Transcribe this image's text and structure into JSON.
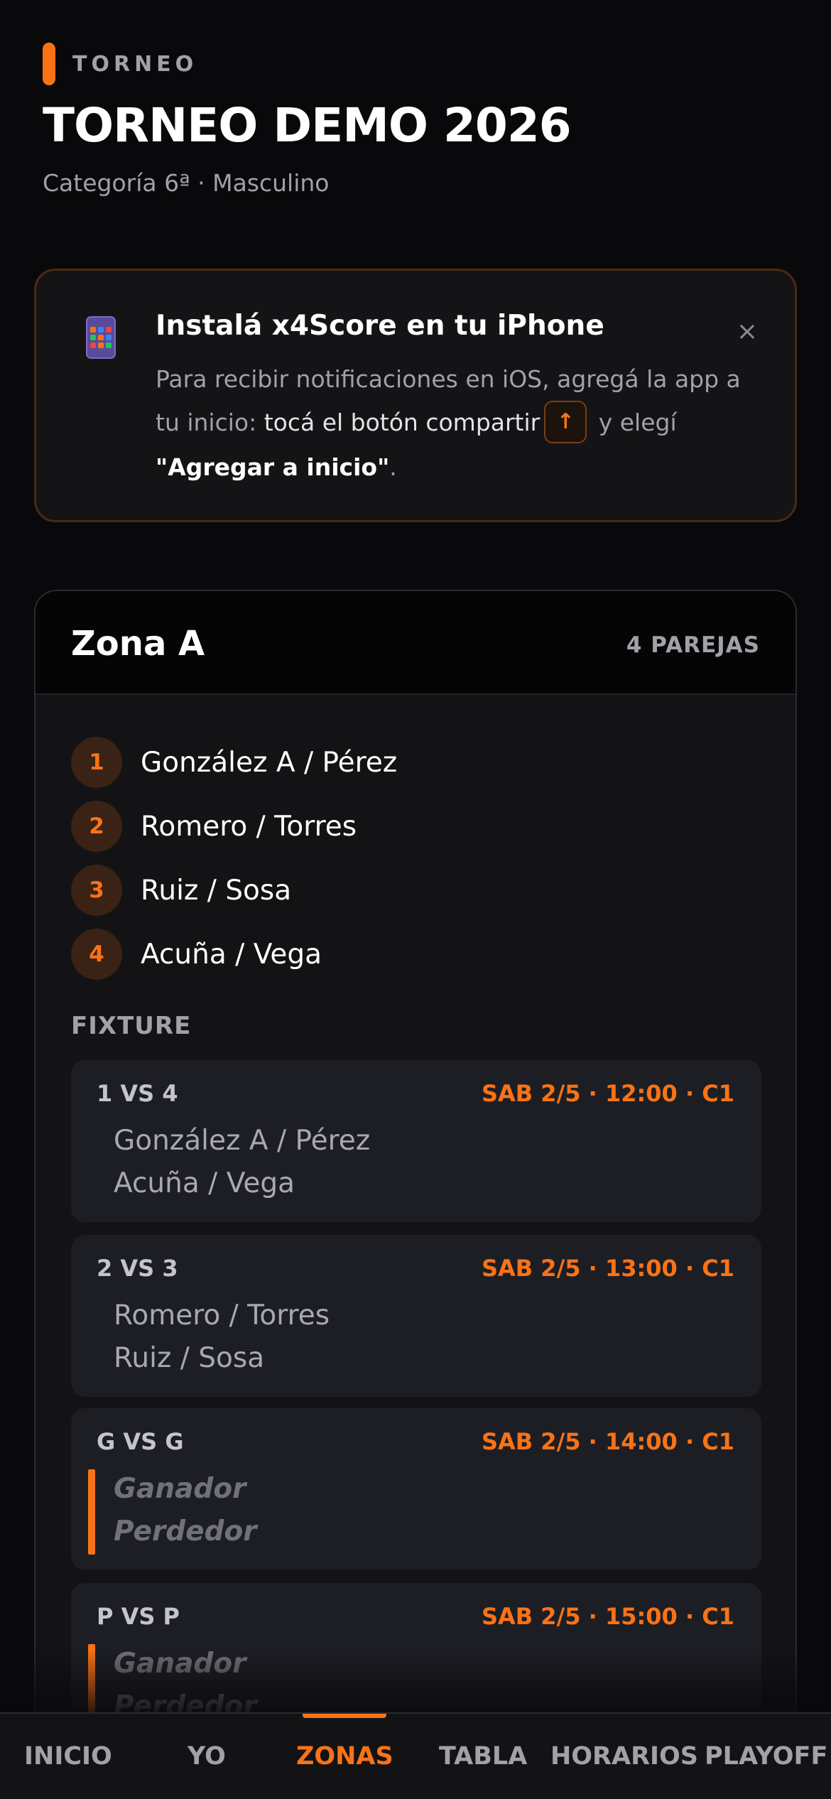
{
  "header": {
    "eyebrow": "TORNEO",
    "title": "TORNEO DEMO 2026",
    "subtitle": "Categoría 6ª · Masculino"
  },
  "install_banner": {
    "icon": "phone-app-icon",
    "title": "Instalá x4Score en tu iPhone",
    "body_part1": "Para recibir notificaciones en iOS, agregá la app a tu inicio: ",
    "body_part2": "tocá el botón compartir",
    "share_glyph": "↑",
    "body_part3": " y elegí ",
    "body_part4": "\"Agregar a inicio\"",
    "body_part5": ".",
    "close_glyph": "×"
  },
  "zone": {
    "title": "Zona A",
    "count_label": "4 PAREJAS",
    "teams": [
      {
        "rank": "1",
        "name": "González A / Pérez"
      },
      {
        "rank": "2",
        "name": "Romero / Torres"
      },
      {
        "rank": "3",
        "name": "Ruiz / Sosa"
      },
      {
        "rank": "4",
        "name": "Acuña / Vega"
      }
    ],
    "fixture_label": "FIXTURE",
    "matches": [
      {
        "code": "1 VS 4",
        "time": "SAB 2/5 · 12:00 · C1",
        "team_a": "González A / Pérez",
        "team_b": "Acuña / Vega"
      },
      {
        "code": "2 VS 3",
        "time": "SAB 2/5 · 13:00 · C1",
        "team_a": "Romero / Torres",
        "team_b": "Ruiz / Sosa"
      },
      {
        "code": "G VS G",
        "time": "SAB 2/5 · 14:00 · C1",
        "team_a": "Ganador",
        "team_b": "Perdedor"
      },
      {
        "code": "P VS P",
        "time": "SAB 2/5 · 15:00 · C1",
        "team_a": "Ganador",
        "team_b": "Perdedor"
      }
    ]
  },
  "nav": {
    "items": [
      "INICIO",
      "YO",
      "ZONAS",
      "TABLA",
      "HORARIOS",
      "PLAYOFF"
    ],
    "active": "ZONAS"
  },
  "colors": {
    "accent": "#f97316",
    "background": "#09090b",
    "card": "#131316"
  }
}
